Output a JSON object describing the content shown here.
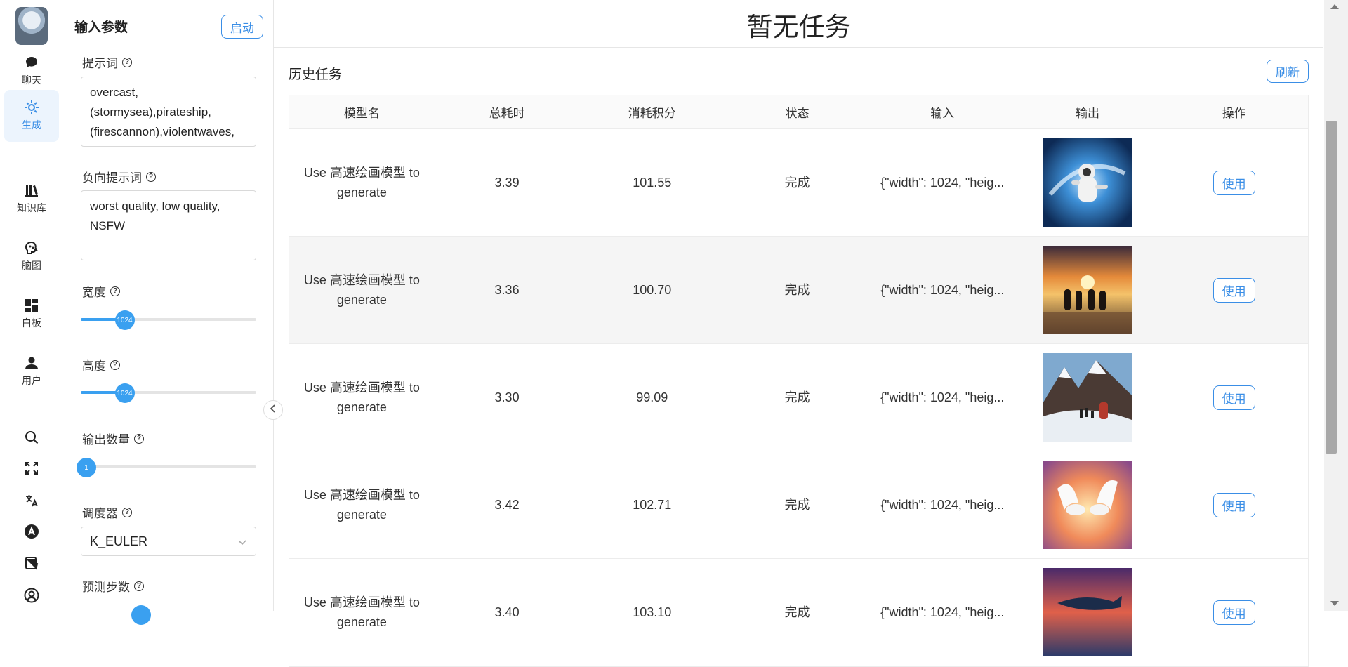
{
  "nav": {
    "items": [
      {
        "label": "聊天",
        "icon": "chat-icon"
      },
      {
        "label": "生成",
        "icon": "generate-icon"
      },
      {
        "label": "知识库",
        "icon": "library-icon"
      },
      {
        "label": "脑图",
        "icon": "brain-icon"
      },
      {
        "label": "白板",
        "icon": "dashboard-icon"
      },
      {
        "label": "用户",
        "icon": "user-icon"
      }
    ],
    "active": "生成",
    "tools": [
      "search-icon",
      "fullscreen-icon",
      "translate-icon",
      "font-icon",
      "theme-icon",
      "account-icon"
    ]
  },
  "params": {
    "title": "输入参数",
    "start_label": "启动",
    "prompt_label": "提示词",
    "prompt_value": "overcast, (stormysea),pirateship, (firescannon),violentwaves,",
    "negative_label": "负向提示词",
    "negative_value": "worst quality, low quality, NSFW",
    "width_label": "宽度",
    "width_value": "1024",
    "width_fraction": 0.25,
    "height_label": "高度",
    "height_value": "1024",
    "height_fraction": 0.25,
    "count_label": "输出数量",
    "count_value": "1",
    "count_fraction": 0.0,
    "scheduler_label": "调度器",
    "scheduler_value": "K_EULER",
    "steps_label": "预测步数"
  },
  "main": {
    "title": "暂无任务",
    "history_title": "历史任务",
    "refresh_label": "刷新",
    "columns": [
      "模型名",
      "总耗时",
      "消耗积分",
      "状态",
      "输入",
      "输出",
      "操作"
    ],
    "use_label": "使用",
    "rows": [
      {
        "model": "Use 高速绘画模型 to generate",
        "time": "3.39",
        "points": "101.55",
        "status": "完成",
        "input": "{\"width\": 1024, \"heig...",
        "thumb": "astronaut"
      },
      {
        "model": "Use 高速绘画模型 to generate",
        "time": "3.36",
        "points": "100.70",
        "status": "完成",
        "input": "{\"width\": 1024, \"heig...",
        "thumb": "sunset"
      },
      {
        "model": "Use 高速绘画模型 to generate",
        "time": "3.30",
        "points": "99.09",
        "status": "完成",
        "input": "{\"width\": 1024, \"heig...",
        "thumb": "mountain"
      },
      {
        "model": "Use 高速绘画模型 to generate",
        "time": "3.42",
        "points": "102.71",
        "status": "完成",
        "input": "{\"width\": 1024, \"heig...",
        "thumb": "doves"
      },
      {
        "model": "Use 高速绘画模型 to generate",
        "time": "3.40",
        "points": "103.10",
        "status": "完成",
        "input": "{\"width\": 1024, \"heig...",
        "thumb": "whale"
      }
    ]
  }
}
